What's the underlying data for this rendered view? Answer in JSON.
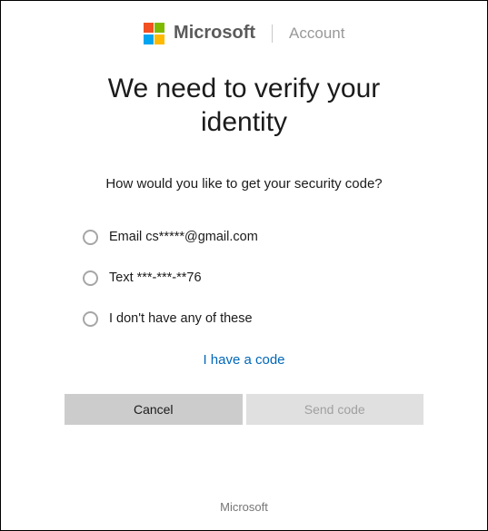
{
  "header": {
    "brand": "Microsoft",
    "section": "Account"
  },
  "title": "We need to verify your identity",
  "prompt": "How would you like to get your security code?",
  "options": [
    {
      "label": "Email cs*****@gmail.com"
    },
    {
      "label": "Text ***-***-**76"
    },
    {
      "label": "I don't have any of these"
    }
  ],
  "have_code_link": "I have a code",
  "buttons": {
    "cancel": "Cancel",
    "send": "Send code"
  },
  "footer": "Microsoft"
}
